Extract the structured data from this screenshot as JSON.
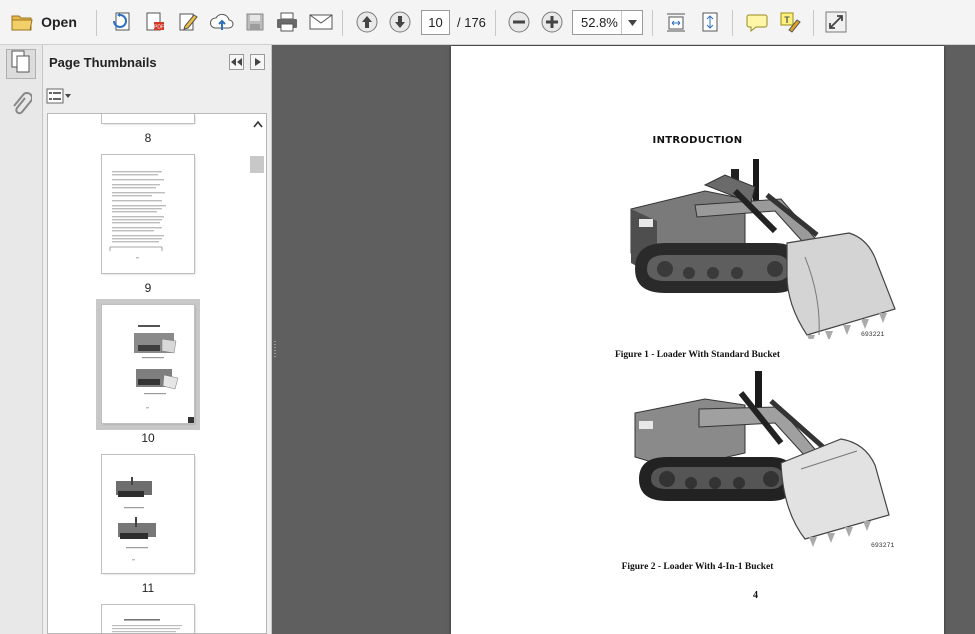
{
  "toolbar": {
    "open_label": "Open",
    "page_current": "10",
    "page_total": "/ 176",
    "zoom": "52.8%",
    "icons": [
      "folder-icon",
      "create-pdf-icon",
      "export-pdf-icon",
      "edit-icon",
      "upload-cloud-icon",
      "save-icon",
      "print-icon",
      "email-icon",
      "page-up-icon",
      "page-down-icon",
      "zoom-out-icon",
      "zoom-in-icon",
      "fit-width-icon",
      "fit-page-icon",
      "comment-icon",
      "highlight-icon",
      "expand-icon"
    ]
  },
  "sidebar": {
    "title": "Page Thumbnails",
    "thumbnails": [
      {
        "label": "8"
      },
      {
        "label": "9"
      },
      {
        "label": "10",
        "selected": true
      },
      {
        "label": "11"
      }
    ]
  },
  "document": {
    "heading": "INTRODUCTION",
    "figures": [
      {
        "caption": "Figure 1 - Loader With Standard Bucket",
        "photo_id": "693221"
      },
      {
        "caption": "Figure 2 - Loader With 4-In-1 Bucket",
        "photo_id": "693271"
      }
    ],
    "page_number": "4"
  },
  "colors": {
    "toolbar_bg": "#f4f4f4",
    "panel_bg": "#eeeeee",
    "doc_bg": "#5f5f5f",
    "accent_blue": "#2f6fc0"
  }
}
